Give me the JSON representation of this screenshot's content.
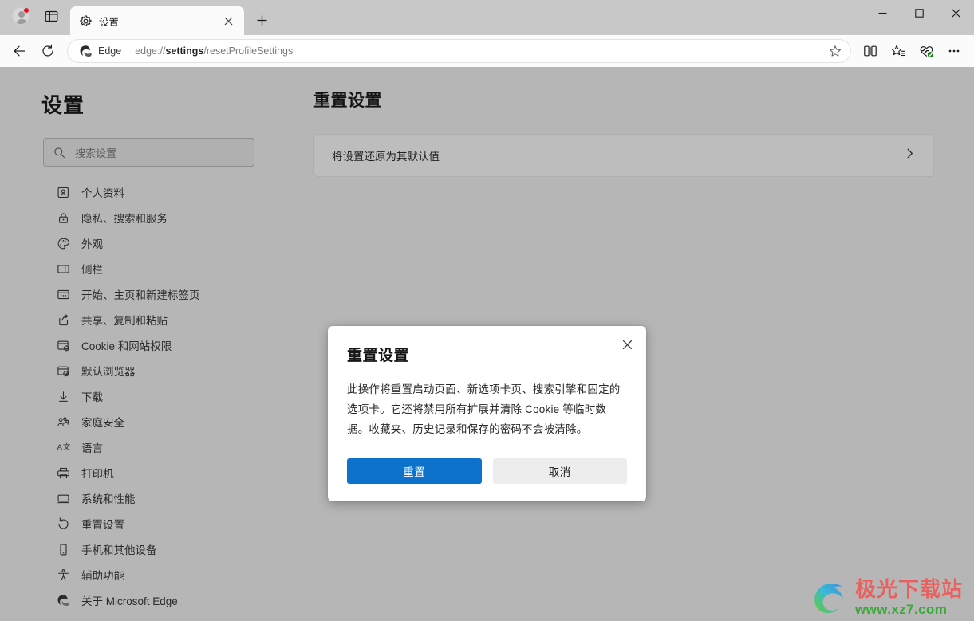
{
  "window": {
    "controls": {
      "minimize": "minimize-icon",
      "maximize": "maximize-icon",
      "close": "close-icon"
    }
  },
  "tabstrip": {
    "profile_icon": "avatar-icon",
    "tab_actions_icon": "tab-actions-icon",
    "tab": {
      "icon": "gear-icon",
      "title": "设置",
      "close_icon": "close-icon"
    },
    "new_tab_icon": "plus-icon"
  },
  "toolbar": {
    "back_icon": "back-arrow-icon",
    "reload_icon": "reload-icon",
    "omnibox": {
      "brand_icon": "edge-logo-icon",
      "brand_label": "Edge",
      "url_prefix": "edge://",
      "url_strong": "settings",
      "url_suffix": "/resetProfileSettings",
      "favorite_icon": "star-icon"
    },
    "split_screen_icon": "split-screen-icon",
    "collections_icon": "collections-icon",
    "browser_essentials_icon": "browser-essentials-icon",
    "settings_more_icon": "ellipsis-icon"
  },
  "sidebar": {
    "title": "设置",
    "search": {
      "icon": "search-icon",
      "placeholder": "搜索设置",
      "value": ""
    },
    "items": [
      {
        "icon": "profile-icon",
        "label": "个人资料"
      },
      {
        "icon": "lock-icon",
        "label": "隐私、搜索和服务"
      },
      {
        "icon": "palette-icon",
        "label": "外观"
      },
      {
        "icon": "sidebar-icon",
        "label": "侧栏"
      },
      {
        "icon": "startpage-icon",
        "label": "开始、主页和新建标签页"
      },
      {
        "icon": "share-icon",
        "label": "共享、复制和粘贴"
      },
      {
        "icon": "cookie-icon",
        "label": "Cookie 和网站权限"
      },
      {
        "icon": "default-browser-icon",
        "label": "默认浏览器"
      },
      {
        "icon": "download-icon",
        "label": "下载"
      },
      {
        "icon": "family-icon",
        "label": "家庭安全"
      },
      {
        "icon": "language-icon",
        "label": "语言"
      },
      {
        "icon": "printer-icon",
        "label": "打印机"
      },
      {
        "icon": "system-icon",
        "label": "系统和性能"
      },
      {
        "icon": "reset-icon",
        "label": "重置设置"
      },
      {
        "icon": "phone-icon",
        "label": "手机和其他设备"
      },
      {
        "icon": "accessibility-icon",
        "label": "辅助功能"
      },
      {
        "icon": "edge-logo-icon",
        "label": "关于 Microsoft Edge"
      }
    ],
    "active_index": 13
  },
  "main": {
    "title": "重置设置",
    "card": {
      "label": "将设置还原为其默认值",
      "chevron_icon": "chevron-right-icon"
    }
  },
  "dialog": {
    "title": "重置设置",
    "close_icon": "close-icon",
    "body": "此操作将重置启动页面、新选项卡页、搜索引擎和固定的选项卡。它还将禁用所有扩展并清除 Cookie 等临时数据。收藏夹、历史记录和保存的密码不会被清除。",
    "primary_label": "重置",
    "secondary_label": "取消",
    "primary_color": "#0c72cb",
    "secondary_color": "#ededed"
  },
  "watermark": {
    "name": "极光下载站",
    "url": "www.xz7.com",
    "logo_icon": "aurora-swirl-icon"
  }
}
